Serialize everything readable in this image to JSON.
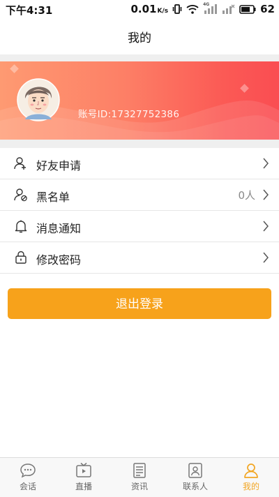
{
  "status": {
    "time": "下午4:31",
    "speed": "0.01",
    "speed_unit": "K/s",
    "battery": "62",
    "net_badge": "4G"
  },
  "header": {
    "title": "我的"
  },
  "profile": {
    "account_label": "账号ID:17327752386"
  },
  "menu": [
    {
      "label": "好友申请",
      "value": "",
      "icon": "add-friend-icon"
    },
    {
      "label": "黑名单",
      "value": "0人",
      "icon": "blocked-user-icon"
    },
    {
      "label": "消息通知",
      "value": "",
      "icon": "bell-icon"
    },
    {
      "label": "修改密码",
      "value": "",
      "icon": "lock-icon"
    }
  ],
  "logout": {
    "label": "退出登录"
  },
  "tabs": [
    {
      "label": "会话",
      "icon": "chat-icon"
    },
    {
      "label": "直播",
      "icon": "tv-icon"
    },
    {
      "label": "资讯",
      "icon": "news-icon"
    },
    {
      "label": "联系人",
      "icon": "contacts-icon"
    },
    {
      "label": "我的",
      "icon": "person-icon",
      "active": true
    }
  ],
  "colors": {
    "accent": "#f7a21b",
    "banner_start": "#fe9a72",
    "banner_end": "#fa4d52",
    "tab_active": "#f2a623"
  }
}
